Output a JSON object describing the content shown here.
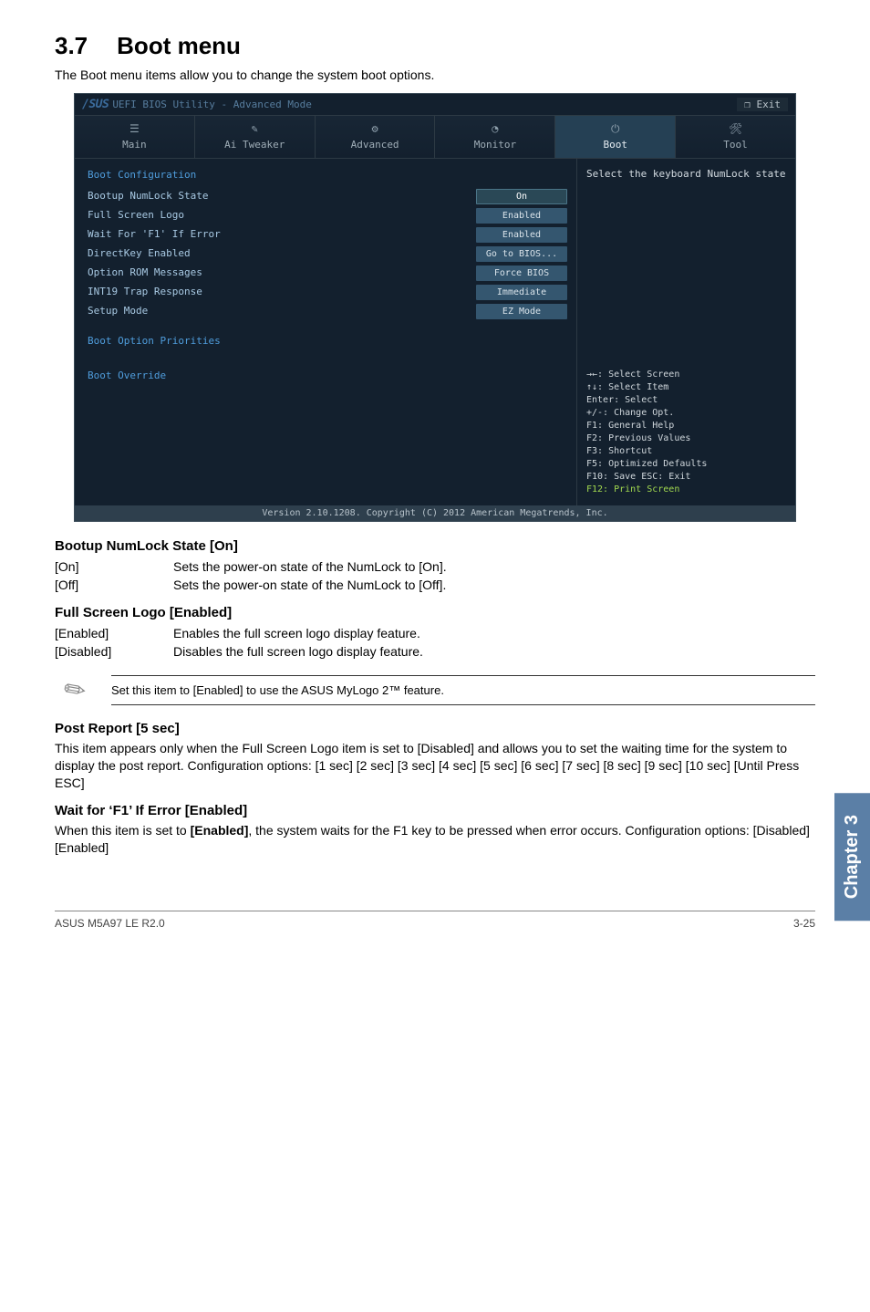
{
  "page": {
    "section_number": "3.7",
    "section_title": "Boot menu",
    "intro": "The Boot menu items allow you to change the system boot options.",
    "footer_model": "ASUS M5A97 LE R2.0",
    "footer_page": "3-25",
    "chapter_tab": "Chapter 3"
  },
  "bios": {
    "brand": "/SUS",
    "subtitle": "UEFI BIOS Utility - Advanced Mode",
    "exit": "Exit",
    "tabs": {
      "main": "Main",
      "ai": "Ai Tweaker",
      "adv": "Advanced",
      "mon": "Monitor",
      "boot": "Boot",
      "tool": "Tool"
    },
    "cfg_header": "Boot Configuration",
    "rows": {
      "numlock_label": "Bootup NumLock State",
      "numlock_val": "On",
      "fullscreen_label": "Full Screen Logo",
      "fullscreen_val": "Enabled",
      "waitf1_label": "Wait For 'F1' If Error",
      "waitf1_val": "Enabled",
      "directkey_label": "DirectKey Enabled",
      "directkey_val": "Go to BIOS...",
      "optionrom_label": "Option ROM Messages",
      "optionrom_val": "Force BIOS",
      "int19_label": "INT19 Trap Response",
      "int19_val": "Immediate",
      "setupmode_label": "Setup Mode",
      "setupmode_val": "EZ Mode"
    },
    "sections": {
      "priorities": "Boot Option Priorities",
      "override": "Boot Override"
    },
    "help_text": "Select the keyboard NumLock state",
    "keys": {
      "k1": "→←: Select Screen",
      "k2": "↑↓: Select Item",
      "k3": "Enter: Select",
      "k4": "+/-: Change Opt.",
      "k5": "F1: General Help",
      "k6": "F2: Previous Values",
      "k7": "F3: Shortcut",
      "k8": "F5: Optimized Defaults",
      "k9": "F10: Save  ESC: Exit",
      "k10": "F12: Print Screen"
    },
    "copyright": "Version 2.10.1208. Copyright (C) 2012 American Megatrends, Inc."
  },
  "options": {
    "numlock": {
      "heading": "Bootup NumLock State [On]",
      "on_key": "[On]",
      "on_desc": "Sets the power-on state of the NumLock to [On].",
      "off_key": "[Off]",
      "off_desc": "Sets the power-on state of the NumLock to [Off]."
    },
    "fullscreen": {
      "heading": "Full Screen Logo [Enabled]",
      "en_key": "[Enabled]",
      "en_desc": "Enables the full screen logo display feature.",
      "dis_key": "[Disabled]",
      "dis_desc": "Disables the full screen logo display feature."
    },
    "note": "Set this item to [Enabled] to use the ASUS MyLogo 2™ feature.",
    "post": {
      "heading": "Post Report [5 sec]",
      "body": "This item appears only when the Full Screen Logo item is set to [Disabled] and allows you to set the waiting time for the system to display the post report. Configuration options: [1 sec] [2 sec] [3 sec] [4 sec] [5 sec] [6 sec] [7 sec] [8 sec] [9 sec] [10 sec] [Until Press ESC]"
    },
    "waitf1": {
      "heading": "Wait for ‘F1’ If Error [Enabled]",
      "body_pre": "When this item is set to ",
      "body_bold": "[Enabled]",
      "body_post": ", the system waits for the F1 key to be pressed when error occurs. Configuration options: [Disabled] [Enabled]"
    }
  },
  "chart_data": {
    "type": "table",
    "title": "Boot Configuration",
    "rows": [
      {
        "label": "Bootup NumLock State",
        "value": "On"
      },
      {
        "label": "Full Screen Logo",
        "value": "Enabled"
      },
      {
        "label": "Wait For 'F1' If Error",
        "value": "Enabled"
      },
      {
        "label": "DirectKey Enabled",
        "value": "Go to BIOS..."
      },
      {
        "label": "Option ROM Messages",
        "value": "Force BIOS"
      },
      {
        "label": "INT19 Trap Response",
        "value": "Immediate"
      },
      {
        "label": "Setup Mode",
        "value": "EZ Mode"
      }
    ]
  }
}
